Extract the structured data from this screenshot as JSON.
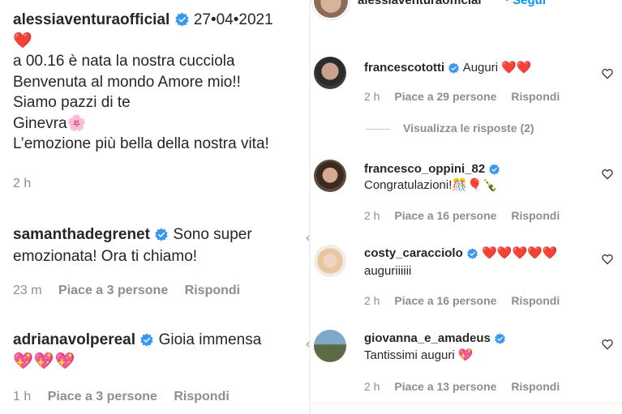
{
  "left": {
    "caption": {
      "username": "alessiaventuraofficial",
      "date": "27•04•2021",
      "heart": "❤️",
      "lines": [
        "a 00.16 è nata la nostra cucciola",
        "Benvenuta al mondo Amore mio!!",
        "Siamo pazzi di te",
        "Ginevra🌸",
        "L’emozione più bella della nostra vita!"
      ],
      "time": "2 h"
    },
    "comments": [
      {
        "username": "samanthadegrenet",
        "text_line1": "Sono super",
        "text_line2": "emozionata! Ora ti chiamo!",
        "time": "23 m",
        "likes": "Piace a 3 persone",
        "reply": "Rispondi"
      },
      {
        "username": "adrianavolpereal",
        "text_line1": "Gioia immensa",
        "text_line2": "💖💖💖",
        "time": "1 h",
        "likes": "Piace a 3 persone",
        "reply": "Rispondi"
      }
    ],
    "caret": "‹"
  },
  "right": {
    "header": {
      "username": "alessiaventuraofficial",
      "follow": "· Segui",
      "more": "···"
    },
    "comments": [
      {
        "username": "francescototti",
        "text_inline": "Auguri ❤️❤️",
        "text_line2": "",
        "time": "2 h",
        "likes": "Piace a 29 persone",
        "reply": "Rispondi",
        "view_replies": "Visualizza le risposte (2)"
      },
      {
        "username": "francesco_oppini_82",
        "text_inline": "",
        "text_line2": "Congratulazioni!🎊🎈🍾",
        "time": "2 h",
        "likes": "Piace a 16 persone",
        "reply": "Rispondi"
      },
      {
        "username": "costy_caracciolo",
        "text_inline": "❤️❤️❤️❤️❤️",
        "text_line2": "auguriiiiii",
        "time": "2 h",
        "likes": "Piace a 16 persone",
        "reply": "Rispondi"
      },
      {
        "username": "giovanna_e_amadeus",
        "text_inline": "",
        "text_line2": "Tantissimi auguri 💖",
        "time": "2 h",
        "likes": "Piace a 13 persone",
        "reply": "Rispondi"
      }
    ]
  },
  "colors": {
    "text": "#262626",
    "muted": "#8e8e8e",
    "verified": "#3897f0",
    "link": "#0095f6",
    "heart_red": "#ed1c3a"
  },
  "icons": [
    "verified-badge-icon",
    "heart-outline-icon",
    "more-icon"
  ]
}
